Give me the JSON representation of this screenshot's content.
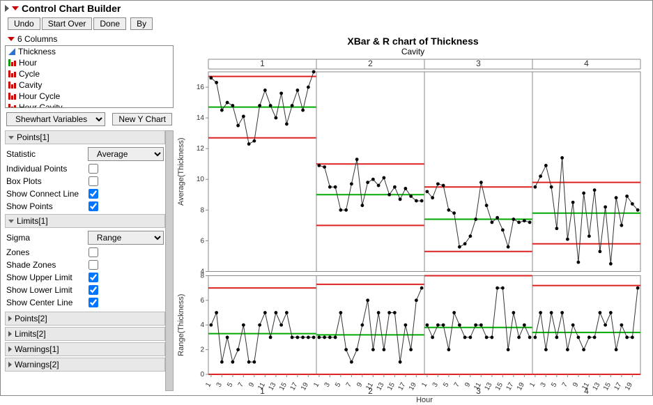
{
  "window_title": "Control Chart Builder",
  "toolbar": {
    "undo": "Undo",
    "start_over": "Start Over",
    "done": "Done",
    "by": "By"
  },
  "columns_header": "6 Columns",
  "columns": [
    {
      "label": "Thickness",
      "icon": "cont"
    },
    {
      "label": "Hour",
      "icon": "nom-green"
    },
    {
      "label": "Cycle",
      "icon": "nom-red"
    },
    {
      "label": "Cavity",
      "icon": "nom-red"
    },
    {
      "label": "Hour Cycle",
      "icon": "nom-red"
    },
    {
      "label": "Hour Cavity",
      "icon": "nom-red"
    }
  ],
  "chart_type_select": "Shewhart Variables",
  "new_y_btn": "New Y Chart",
  "sections": {
    "points1": {
      "title": "Points[1]",
      "statistic_label": "Statistic",
      "statistic_value": "Average",
      "individual_points": {
        "label": "Individual Points",
        "checked": false
      },
      "box_plots": {
        "label": "Box Plots",
        "checked": false
      },
      "show_connect_line": {
        "label": "Show Connect Line",
        "checked": true
      },
      "show_points": {
        "label": "Show Points",
        "checked": true
      }
    },
    "limits1": {
      "title": "Limits[1]",
      "sigma_label": "Sigma",
      "sigma_value": "Range",
      "zones": {
        "label": "Zones",
        "checked": false
      },
      "shade_zones": {
        "label": "Shade Zones",
        "checked": false
      },
      "show_upper": {
        "label": "Show Upper Limit",
        "checked": true
      },
      "show_lower": {
        "label": "Show Lower Limit",
        "checked": true
      },
      "show_center": {
        "label": "Show Center Line",
        "checked": true
      }
    },
    "points2": "Points[2]",
    "limits2": "Limits[2]",
    "warnings1": "Warnings[1]",
    "warnings2": "Warnings[2]"
  },
  "chart": {
    "title": "XBar & R chart of Thickness",
    "facet_var": "Cavity",
    "x_var": "Hour",
    "y1_label": "Average(Thickness)",
    "y2_label": "Range(Thickness)"
  },
  "chart_data": {
    "type": "control-chart",
    "facets": [
      "1",
      "2",
      "3",
      "4"
    ],
    "x_ticks": [
      1,
      3,
      5,
      7,
      9,
      11,
      13,
      15,
      17,
      19
    ],
    "xbar": {
      "ylabel": "Average(Thickness)",
      "ylim": [
        4,
        17
      ],
      "yticks": [
        4,
        6,
        8,
        10,
        12,
        14,
        16
      ],
      "panels": [
        {
          "facet": "1",
          "cl": 14.7,
          "ucl": 16.7,
          "lcl": 12.7,
          "values": [
            16.6,
            16.3,
            14.5,
            15.0,
            14.8,
            13.5,
            14.1,
            12.3,
            12.5,
            14.8,
            15.8,
            14.8,
            14.0,
            15.6,
            13.6,
            14.8,
            15.8,
            14.5,
            16.0,
            17.0
          ]
        },
        {
          "facet": "2",
          "cl": 9.0,
          "ucl": 11.0,
          "lcl": 7.0,
          "values": [
            10.9,
            10.8,
            9.5,
            9.5,
            8.0,
            8.0,
            9.7,
            11.3,
            8.3,
            9.8,
            10.0,
            9.6,
            10.1,
            9.0,
            9.5,
            8.7,
            9.4,
            8.9,
            8.6,
            8.6
          ]
        },
        {
          "facet": "3",
          "cl": 7.4,
          "ucl": 9.5,
          "lcl": 5.3,
          "values": [
            9.2,
            8.8,
            9.7,
            9.6,
            8.0,
            7.8,
            5.6,
            5.8,
            6.3,
            7.4,
            9.8,
            8.3,
            7.2,
            7.5,
            6.7,
            5.6,
            7.4,
            7.2,
            7.3,
            7.2
          ]
        },
        {
          "facet": "4",
          "cl": 7.8,
          "ucl": 9.8,
          "lcl": 5.8,
          "values": [
            9.5,
            10.2,
            10.9,
            9.5,
            6.8,
            11.4,
            6.1,
            8.5,
            4.6,
            9.1,
            6.3,
            9.3,
            5.3,
            8.2,
            4.5,
            8.8,
            7.0,
            8.9,
            8.4,
            8.0
          ]
        }
      ]
    },
    "range": {
      "ylabel": "Range(Thickness)",
      "ylim": [
        0,
        8
      ],
      "yticks": [
        0,
        2,
        4,
        6,
        8
      ],
      "panels": [
        {
          "facet": "1",
          "cl": 3.3,
          "ucl": 7.0,
          "lcl": 0.0,
          "values": [
            4,
            5,
            1,
            3,
            1,
            2,
            4,
            1,
            1,
            4,
            5,
            3,
            5,
            4,
            5,
            3,
            3,
            3,
            3,
            3
          ]
        },
        {
          "facet": "2",
          "cl": 3.2,
          "ucl": 7.3,
          "lcl": 0.0,
          "values": [
            3,
            3,
            3,
            3,
            5,
            2,
            1,
            2,
            4,
            6,
            2,
            5,
            2,
            5,
            5,
            1,
            4,
            2,
            6,
            7
          ]
        },
        {
          "facet": "3",
          "cl": 3.8,
          "ucl": 8.0,
          "lcl": 0.0,
          "values": [
            4,
            3,
            4,
            4,
            2,
            5,
            4,
            3,
            3,
            4,
            4,
            3,
            3,
            7,
            7,
            2,
            5,
            3,
            4,
            3
          ]
        },
        {
          "facet": "4",
          "cl": 3.4,
          "ucl": 7.2,
          "lcl": 0.0,
          "values": [
            3,
            5,
            2,
            5,
            3,
            5,
            2,
            4,
            3,
            2,
            3,
            3,
            5,
            4,
            5,
            2,
            4,
            3,
            3,
            7
          ]
        }
      ]
    }
  }
}
